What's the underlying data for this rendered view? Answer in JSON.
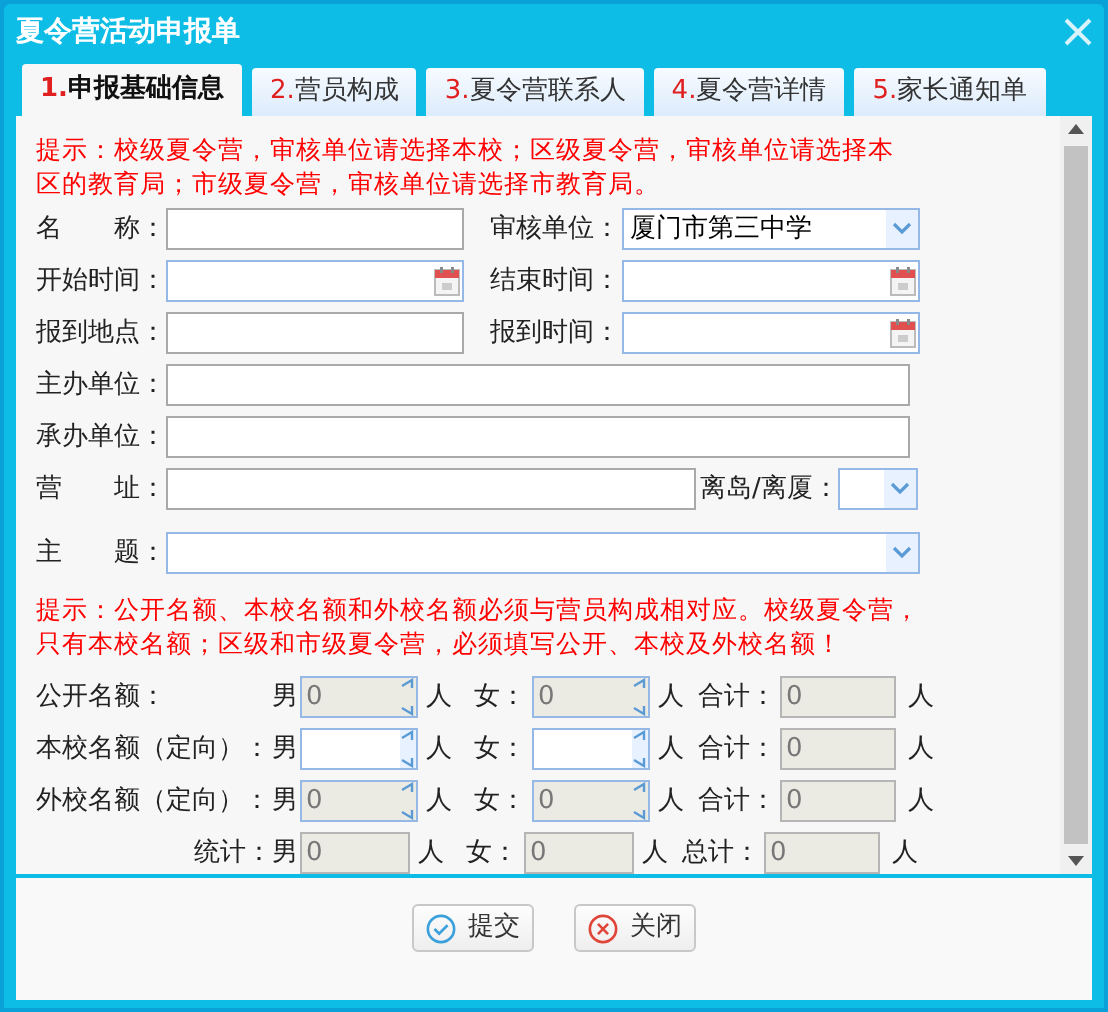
{
  "window": {
    "title": "夏令营活动申报单"
  },
  "tabs": [
    {
      "number": "1.",
      "label": "申报基础信息",
      "selected": true
    },
    {
      "number": "2.",
      "label": "营员构成",
      "selected": false
    },
    {
      "number": "3.",
      "label": "夏令营联系人",
      "selected": false
    },
    {
      "number": "4.",
      "label": "夏令营详情",
      "selected": false
    },
    {
      "number": "5.",
      "label": "家长通知单",
      "selected": false
    }
  ],
  "hint_1": "提示：校级夏令营，审核单位请选择本校；区级夏令营，审核单位请选择本区的教育局；市级夏令营，审核单位请选择市教育局。",
  "form_rows": [
    {
      "kind": "pair",
      "fields": [
        {
          "label": "名　　称：",
          "kind": "text"
        },
        {
          "label": "审核单位：",
          "kind": "select",
          "value": "厦门市第三中学"
        }
      ]
    },
    {
      "kind": "pair",
      "fields": [
        {
          "label": "开始时间：",
          "kind": "date"
        },
        {
          "label": "结束时间：",
          "kind": "date"
        }
      ]
    },
    {
      "kind": "pair",
      "fields": [
        {
          "label": "报到地点：",
          "kind": "text"
        },
        {
          "label": "报到时间：",
          "kind": "date"
        }
      ]
    },
    {
      "kind": "wide",
      "fields": [
        {
          "label": "主办单位：",
          "kind": "text"
        }
      ]
    },
    {
      "kind": "wide",
      "fields": [
        {
          "label": "承办单位：",
          "kind": "text"
        }
      ]
    },
    {
      "kind": "address",
      "fields": [
        {
          "label": "营　　址：",
          "kind": "text"
        },
        {
          "label": "离岛/离厦：",
          "kind": "select"
        }
      ]
    },
    {
      "kind": "wide",
      "fields": [
        {
          "label": "主　　题：",
          "kind": "select"
        }
      ]
    }
  ],
  "hint_2": "提示：公开名额、本校名额和外校名额必须与营员构成相对应。校级夏令营，只有本校名额；区级和市级夏令营，必须填写公开、本校及外校名额！",
  "quota_rows": [
    {
      "kind": "spin",
      "label": "公开名额：",
      "male_label": "男",
      "male": {
        "value": "0",
        "disabled": true
      },
      "male_unit": "人",
      "female_label": "女：",
      "female": {
        "value": "0",
        "disabled": true
      },
      "female_unit": "人",
      "total_label": "合计：",
      "total": "0",
      "total_unit": "人"
    },
    {
      "kind": "spin",
      "label": "本校名额（定向）：",
      "male_label": "男",
      "male": {
        "disabled": false
      },
      "male_unit": "人",
      "female_label": "女：",
      "female": {
        "disabled": false
      },
      "female_unit": "人",
      "total_label": "合计：",
      "total": "0",
      "total_unit": "人"
    },
    {
      "kind": "spin",
      "label": "外校名额（定向）：",
      "male_label": "男",
      "male": {
        "value": "0",
        "disabled": true
      },
      "male_unit": "人",
      "female_label": "女：",
      "female": {
        "value": "0",
        "disabled": true
      },
      "female_unit": "人",
      "total_label": "合计：",
      "total": "0",
      "total_unit": "人"
    },
    {
      "kind": "sum",
      "label": "统计：",
      "male_label": "男",
      "male": {
        "value": "0"
      },
      "male_unit": "人",
      "female_label": "女：",
      "female": {
        "value": "0"
      },
      "female_unit": "人",
      "total_label": "总计：",
      "total": "0",
      "total_unit": "人"
    }
  ],
  "buttons": [
    {
      "kind": "submit",
      "label": "提交"
    },
    {
      "kind": "close",
      "label": "关闭"
    }
  ]
}
